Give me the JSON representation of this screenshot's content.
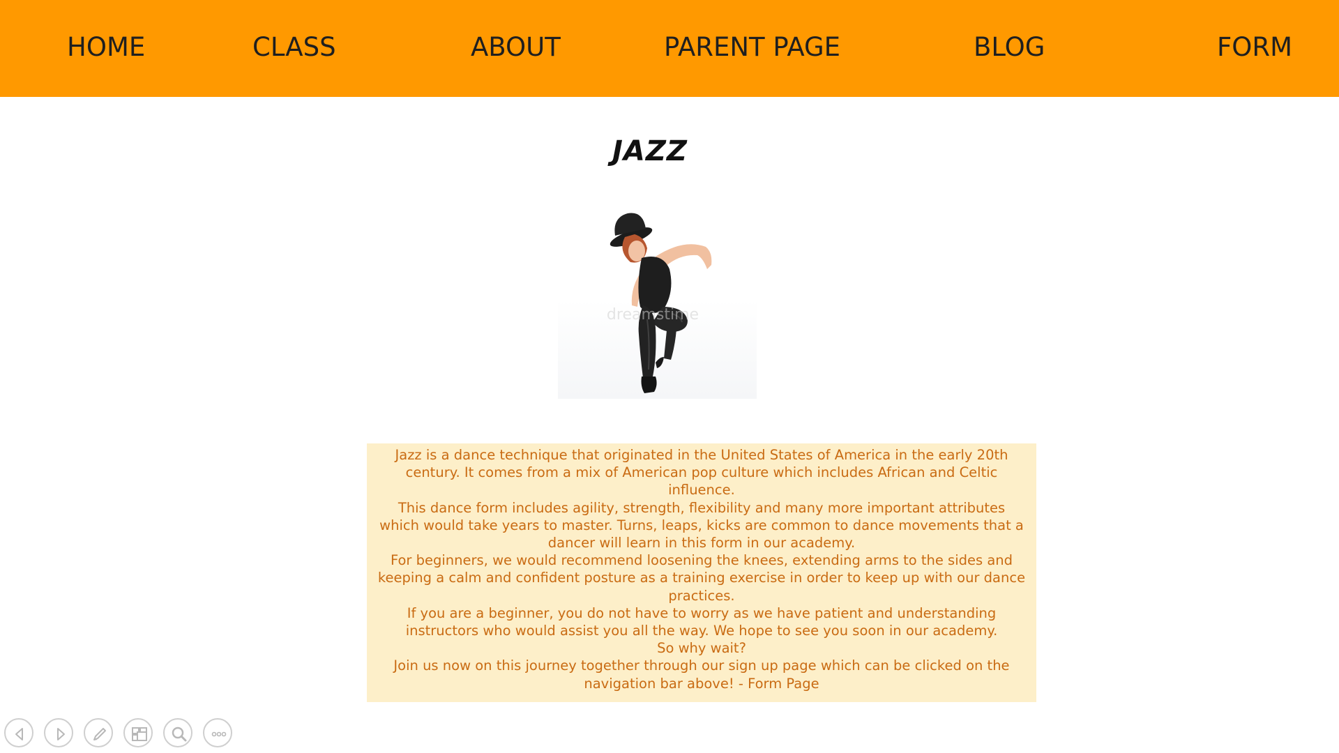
{
  "nav": {
    "items": [
      {
        "label": "HOME"
      },
      {
        "label": "CLASS"
      },
      {
        "label": "ABOUT"
      },
      {
        "label": "PARENT PAGE"
      },
      {
        "label": "BLOG"
      },
      {
        "label": "FORM"
      }
    ],
    "background_color": "#ff9900"
  },
  "main": {
    "title": "JAZZ",
    "image": {
      "watermark": "dreamstime"
    },
    "description": {
      "paragraphs": [
        "Jazz is a dance technique that originated in the United States of America in the early 20th century. It comes from a mix of American pop culture which includes African and Celtic influence.",
        "This dance form includes agility, strength, flexibility and many more important attributes which would take years to master. Turns, leaps, kicks are common to dance movements that a dancer will learn in this form in our academy.",
        "For beginners, we would recommend loosening the knees, extending arms to the sides and keeping a calm and confident posture as a training exercise in order to keep up with our dance practices.",
        "If you are a beginner, you do not have to worry as we have patient and understanding instructors who would assist you all the way. We hope to see you soon in our academy.",
        "So why wait?",
        "Join us now on this journey together through our sign up page which can be clicked on the navigation bar above! - Form Page"
      ],
      "background_color": "#fdefc9",
      "text_color": "#c96b13"
    }
  },
  "toolbar": {
    "buttons": [
      {
        "icon": "previous-icon"
      },
      {
        "icon": "next-icon"
      },
      {
        "icon": "pen-icon"
      },
      {
        "icon": "slides-icon"
      },
      {
        "icon": "zoom-icon"
      },
      {
        "icon": "more-icon"
      }
    ]
  }
}
